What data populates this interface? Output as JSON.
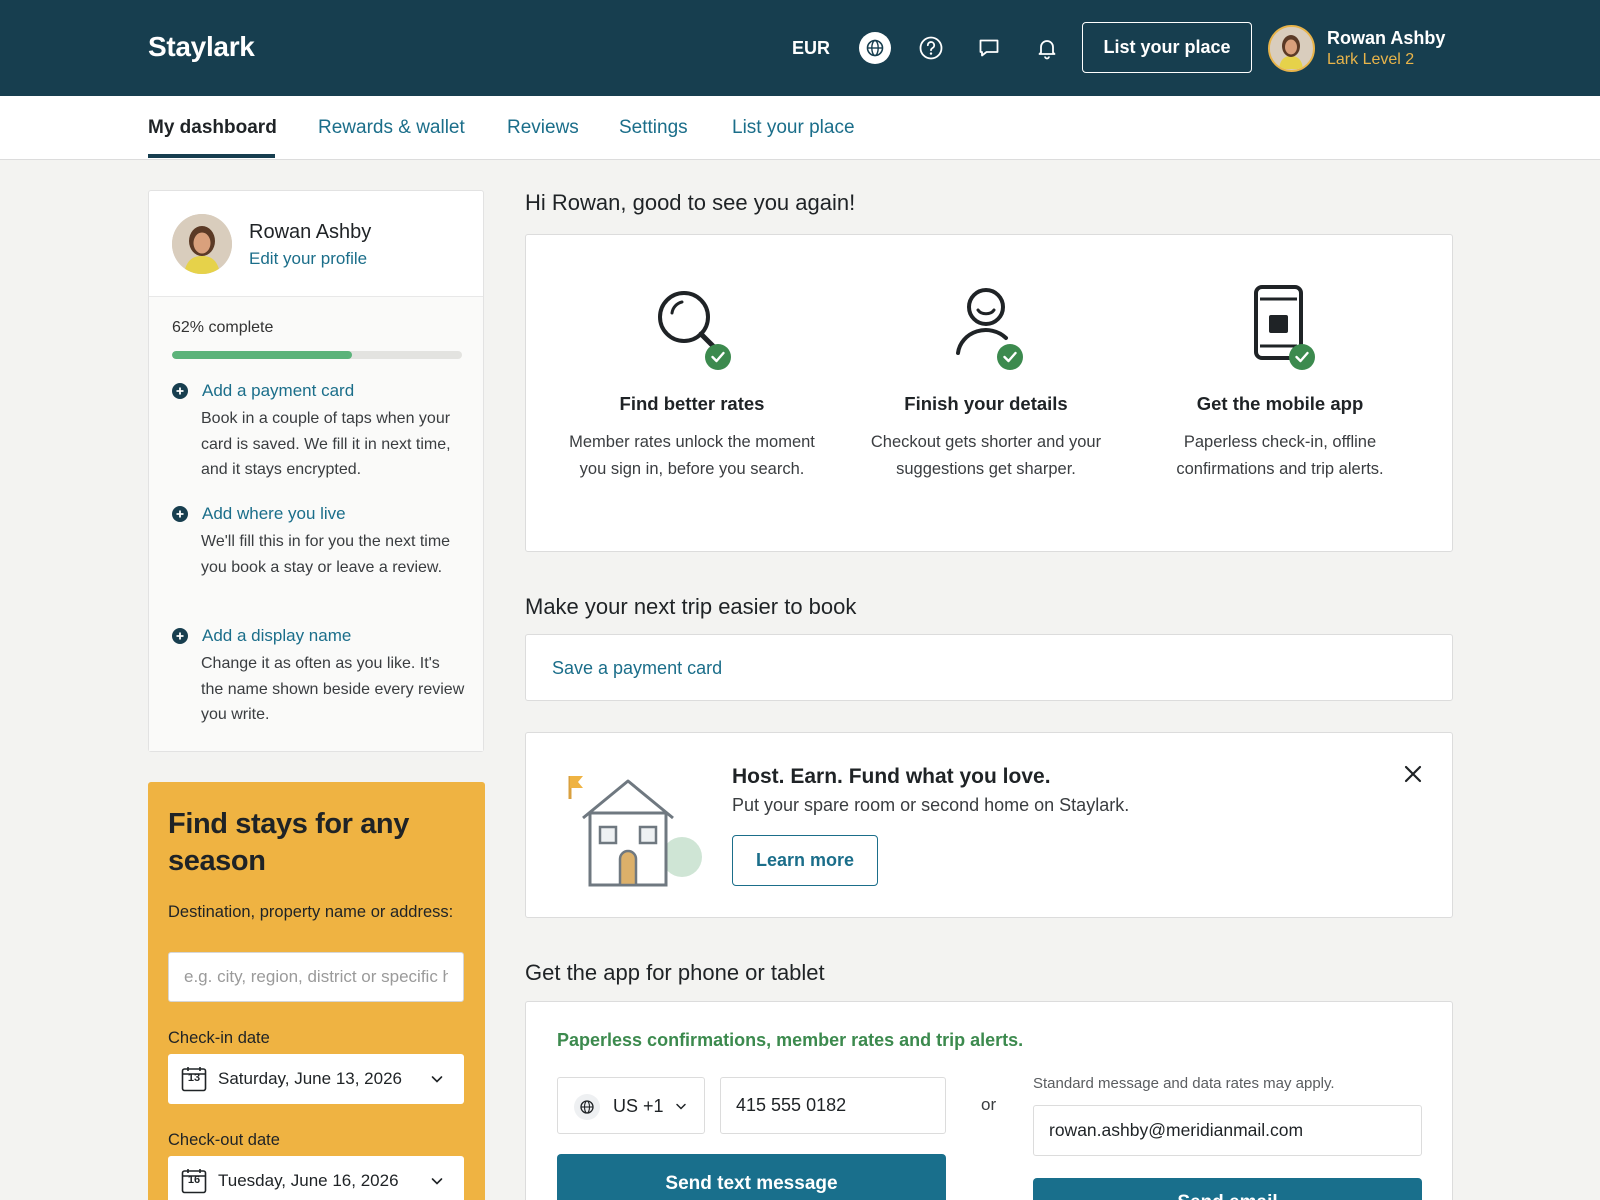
{
  "header": {
    "logo": "Staylark",
    "currency": "EUR",
    "list_place_label": "List your place",
    "user_name": "Rowan Ashby",
    "user_level": "Lark Level 2"
  },
  "nav": {
    "tabs": [
      {
        "label": "My dashboard",
        "active": true
      },
      {
        "label": "Rewards & wallet"
      },
      {
        "label": "Reviews"
      },
      {
        "label": "Settings"
      },
      {
        "label": "List your place"
      }
    ]
  },
  "profile": {
    "name": "Rowan Ashby",
    "edit_label": "Edit your profile",
    "progress_label": "62% complete",
    "progress_value": 0.62,
    "tasks": [
      {
        "title": "Add a payment card",
        "desc": "Book in a couple of taps when your card is saved. We fill it in next time, and it stays encrypted."
      },
      {
        "title": "Add where you live",
        "desc": "We'll fill this in for you the next time you book a stay or leave a review."
      },
      {
        "title": "Add a display name",
        "desc": "Change it as often as you like. It's the name shown beside every review you write."
      }
    ]
  },
  "search": {
    "title": "Find stays for any season",
    "destination_label": "Destination, property name or address:",
    "destination_placeholder": "e.g. city, region, district or specific hotel",
    "checkin_label": "Check-in date",
    "checkin_day": "13",
    "checkin_value": "Saturday, June 13, 2026",
    "checkout_label": "Check-out date",
    "checkout_day": "16",
    "checkout_value": "Tuesday, June 16, 2026"
  },
  "main": {
    "greeting": "Hi Rowan, good to see you again!",
    "features": [
      {
        "icon": "search-check-icon",
        "title": "Find better rates",
        "desc": "Member rates unlock the moment you sign in, before you search."
      },
      {
        "icon": "user-check-icon",
        "title": "Finish your details",
        "desc": "Checkout gets shorter and your suggestions get sharper."
      },
      {
        "icon": "phone-check-icon",
        "title": "Get the mobile app",
        "desc": "Paperless check-in, offline confirmations and trip alerts."
      }
    ],
    "next_trip_title": "Make your next trip easier to book",
    "save_card_label": "Save a payment card",
    "host": {
      "title": "Host. Earn. Fund what you love.",
      "subtitle": "Put your spare room or second home on Staylark.",
      "button": "Learn more"
    },
    "app_section_title": "Get the app for phone or tablet",
    "app": {
      "tagline": "Paperless confirmations, member rates and trip alerts.",
      "country_code": "US +1",
      "phone_value": "415 555 0182",
      "or_label": "or",
      "disclaimer": "Standard message and data rates may apply.",
      "email_value": "rowan.ashby@meridianmail.com",
      "send_text_label": "Send text message",
      "send_email_label": "Send email"
    }
  },
  "colors": {
    "header_bg": "#173e4f",
    "link": "#1b6e8a",
    "accent_gold": "#efb342",
    "success_green": "#3c8a4e",
    "progress_green": "#5bb37a",
    "primary_button": "#196f8c"
  }
}
